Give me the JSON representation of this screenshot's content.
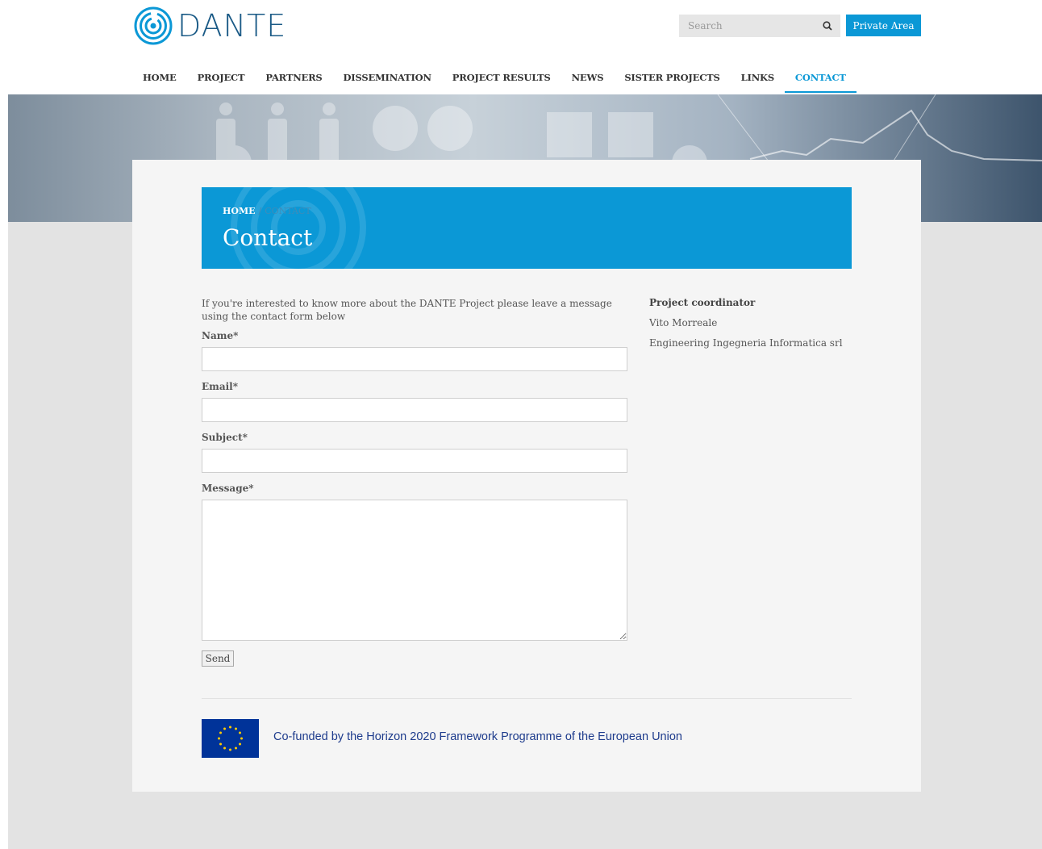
{
  "header": {
    "logo_text": "DANTE",
    "search_placeholder": "Search",
    "private_area_label": "Private Area"
  },
  "nav": {
    "items": [
      "HOME",
      "PROJECT",
      "PARTNERS",
      "DISSEMINATION",
      "PROJECT RESULTS",
      "NEWS",
      "SISTER PROJECTS",
      "LINKS",
      "CONTACT"
    ],
    "active": "CONTACT"
  },
  "breadcrumb": {
    "home": "HOME",
    "separator": "/",
    "current": "CONTACT"
  },
  "page_title": "Contact",
  "form": {
    "intro": "If you're interested to know more about the DANTE Project please leave a message using the contact form below",
    "name_label": "Name*",
    "email_label": "Email*",
    "subject_label": "Subject*",
    "message_label": "Message*",
    "name_value": "",
    "email_value": "",
    "subject_value": "",
    "message_value": "",
    "send_label": "Send"
  },
  "coordinator": {
    "title": "Project coordinator",
    "name": "Vito Morreale",
    "organization": "Engineering Ingegneria Informatica srl"
  },
  "footer": {
    "funding_text": "Co-funded by the Horizon 2020 Framework Programme of the European Union"
  },
  "colors": {
    "accent": "#0b98d6",
    "logo": "#1a5a86",
    "eu_blue": "#003399",
    "eu_star": "#ffcc00"
  },
  "icons": {
    "logo": "dante-logo-icon",
    "search": "search-icon",
    "eu_flag": "eu-flag-icon"
  }
}
